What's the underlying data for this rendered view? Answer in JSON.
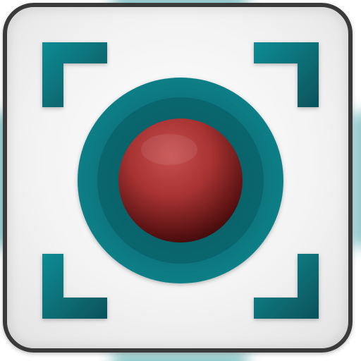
{
  "icon": {
    "name": "screen-capture-record-icon",
    "colors": {
      "tile": "#f1f1f1",
      "tile_border": "#3a3a3a",
      "teal": "#0b7c84",
      "teal_dark": "#06555b",
      "record_red": "#b23a3a",
      "record_dark": "#4a0c0c"
    }
  }
}
